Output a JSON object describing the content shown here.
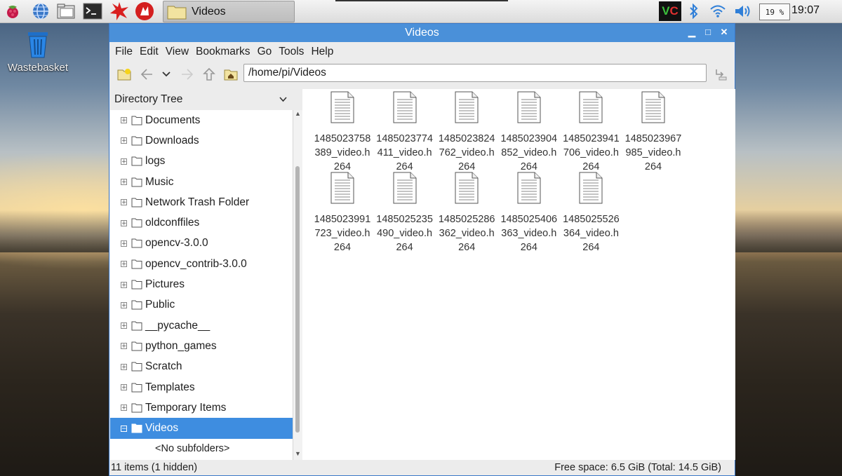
{
  "taskbar": {
    "launchers": [
      "raspberry-menu-icon",
      "web-browser-icon",
      "file-manager-icon",
      "terminal-icon",
      "mathematica-icon",
      "wolfram-icon"
    ],
    "task_label": "Videos",
    "tray": {
      "cpu": "19 %",
      "clock": "19:07"
    }
  },
  "desktop": {
    "wastebasket_label": "Wastebasket"
  },
  "window": {
    "title": "Videos",
    "menu": [
      "File",
      "Edit",
      "View",
      "Bookmarks",
      "Go",
      "Tools",
      "Help"
    ],
    "path": "/home/pi/Videos",
    "tree_header": "Directory Tree",
    "tree": [
      {
        "label": "Documents",
        "exp": "+"
      },
      {
        "label": "Downloads",
        "exp": "+"
      },
      {
        "label": "logs",
        "exp": "+"
      },
      {
        "label": "Music",
        "exp": "+"
      },
      {
        "label": "Network Trash Folder",
        "exp": "+"
      },
      {
        "label": "oldconffiles",
        "exp": "+"
      },
      {
        "label": "opencv-3.0.0",
        "exp": "+"
      },
      {
        "label": "opencv_contrib-3.0.0",
        "exp": "+"
      },
      {
        "label": "Pictures",
        "exp": "+"
      },
      {
        "label": "Public",
        "exp": "+"
      },
      {
        "label": "__pycache__",
        "exp": "+"
      },
      {
        "label": "python_games",
        "exp": "+"
      },
      {
        "label": "Scratch",
        "exp": "+"
      },
      {
        "label": "Templates",
        "exp": "+"
      },
      {
        "label": "Temporary Items",
        "exp": "+"
      },
      {
        "label": "Videos",
        "exp": "−"
      }
    ],
    "no_subfolders": "<No subfolders>",
    "files": [
      "1485023758389_video.h264",
      "1485023774411_video.h264",
      "1485023824762_video.h264",
      "1485023904852_video.h264",
      "1485023941706_video.h264",
      "1485023967985_video.h264",
      "1485023991723_video.h264",
      "1485025235490_video.h264",
      "1485025286362_video.h264",
      "1485025406363_video.h264",
      "1485025526364_video.h264"
    ],
    "status_left": "11 items (1 hidden)",
    "status_right": "Free space: 6.5 GiB (Total: 14.5 GiB)"
  },
  "colors": {
    "titlebar": "#4a90d9",
    "selection": "#3e8de0",
    "folder": "#f2e3a0"
  }
}
